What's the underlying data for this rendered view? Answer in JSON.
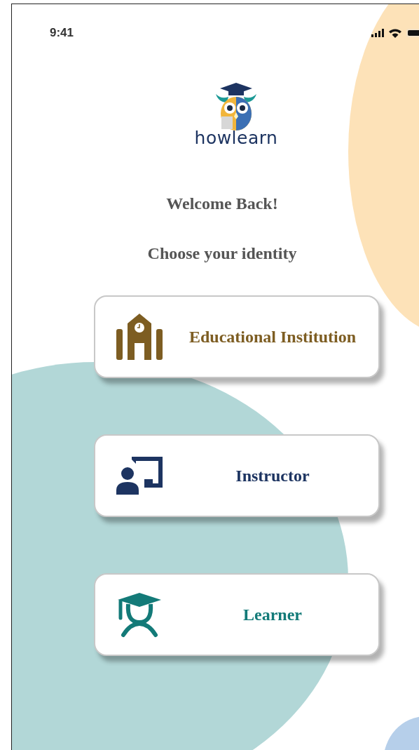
{
  "status_bar": {
    "time": "9:41"
  },
  "logo": {
    "wordmark": "howlearn"
  },
  "welcome": "Welcome Back!",
  "prompt": "Choose your identity",
  "options": [
    {
      "kind": "institution",
      "label": "Educational Institution"
    },
    {
      "kind": "instructor",
      "label": "Instructor"
    },
    {
      "kind": "learner",
      "label": "Learner"
    }
  ]
}
